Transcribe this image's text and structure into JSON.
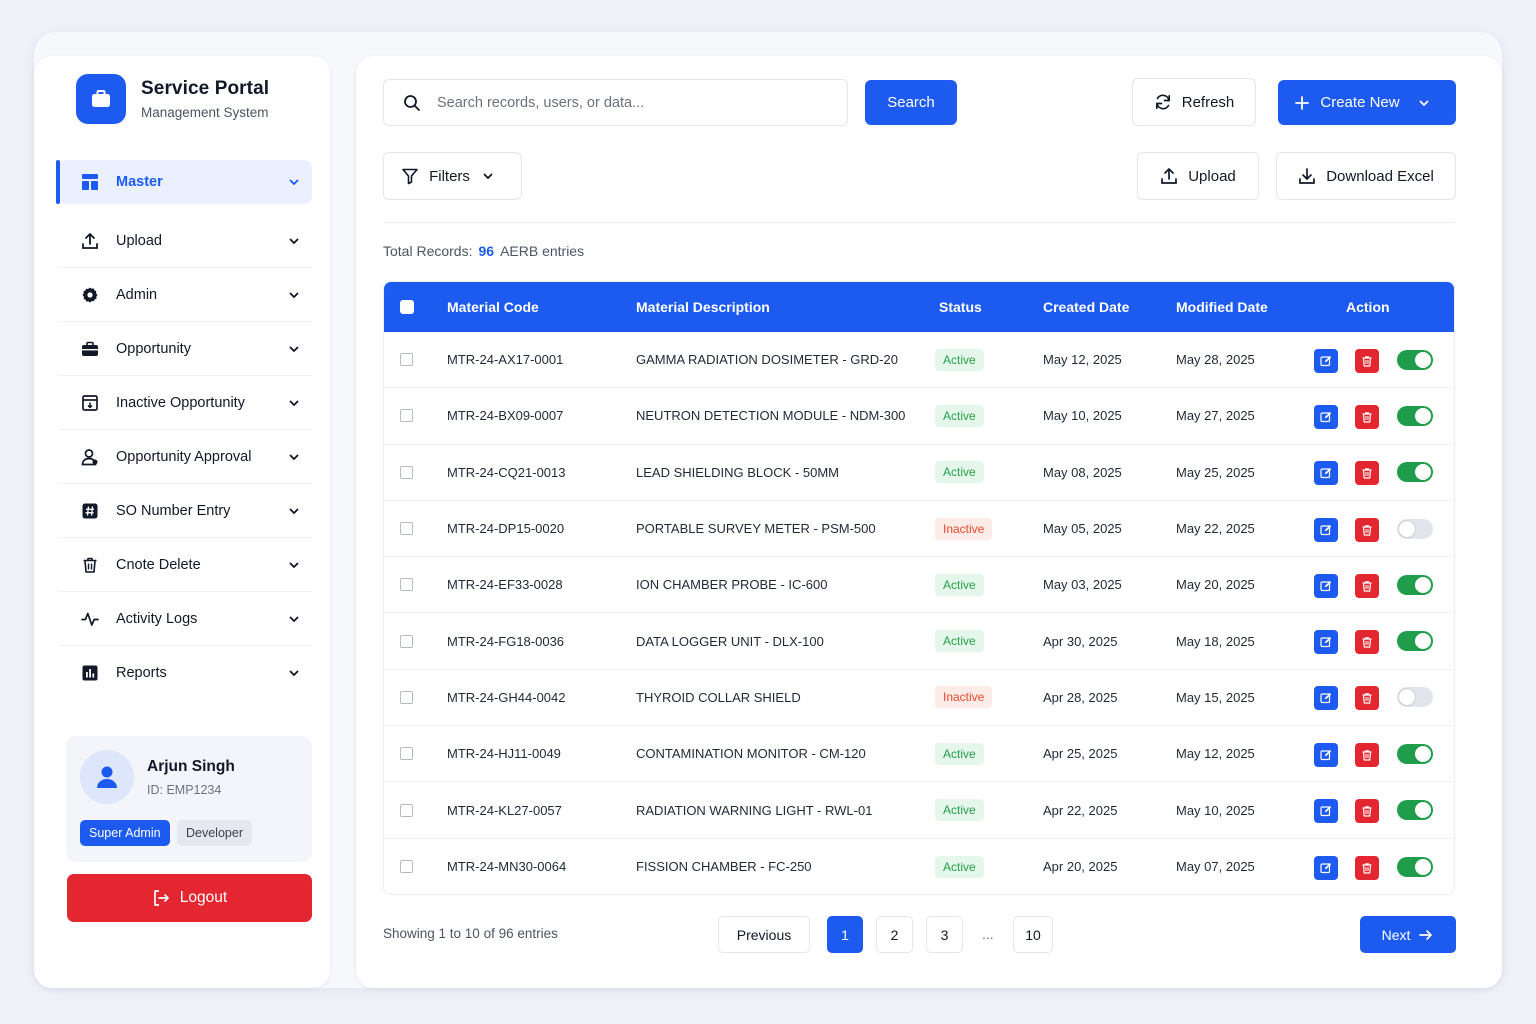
{
  "brand": {
    "title": "Service Portal",
    "subtitle": "Management System"
  },
  "nav": [
    {
      "label": "Master",
      "icon": "layout-icon",
      "active": true
    },
    {
      "label": "Upload",
      "icon": "upload-icon"
    },
    {
      "label": "Admin",
      "icon": "gear-icon"
    },
    {
      "label": "Opportunity",
      "icon": "briefcase-icon"
    },
    {
      "label": "Inactive Opportunity",
      "icon": "archive-icon"
    },
    {
      "label": "Opportunity Approval",
      "icon": "user-check-icon"
    },
    {
      "label": "SO Number Entry",
      "icon": "hash-icon"
    },
    {
      "label": "Cnote Delete",
      "icon": "trash-icon"
    },
    {
      "label": "Activity Logs",
      "icon": "activity-icon"
    },
    {
      "label": "Reports",
      "icon": "bar-chart-icon"
    }
  ],
  "user": {
    "name": "Arjun Singh",
    "id": "ID: EMP1234",
    "roles": [
      "Super Admin",
      "Developer"
    ]
  },
  "logout_label": "Logout",
  "toolbar": {
    "search_placeholder": "Search records, users, or data...",
    "search_label": "Search",
    "refresh_label": "Refresh",
    "create_label": "Create New",
    "filters_label": "Filters",
    "upload_label": "Upload",
    "download_label": "Download Excel"
  },
  "summary": {
    "prefix": "Total Records:",
    "count": "96",
    "suffix": "AERB entries"
  },
  "table": {
    "headers": [
      "Material Code",
      "Material Description",
      "Status",
      "Created Date",
      "Modified Date",
      "Action"
    ],
    "rows": [
      {
        "code": "MTR-24-AX17-0001",
        "desc": "GAMMA RADIATION DOSIMETER - GRD-20",
        "status": "Active",
        "created": "May 12, 2025",
        "modified": "May 28, 2025"
      },
      {
        "code": "MTR-24-BX09-0007",
        "desc": "NEUTRON DETECTION MODULE - NDM-300",
        "status": "Active",
        "created": "May 10, 2025",
        "modified": "May 27, 2025"
      },
      {
        "code": "MTR-24-CQ21-0013",
        "desc": "LEAD SHIELDING BLOCK - 50MM",
        "status": "Active",
        "created": "May 08, 2025",
        "modified": "May 25, 2025"
      },
      {
        "code": "MTR-24-DP15-0020",
        "desc": "PORTABLE SURVEY METER - PSM-500",
        "status": "Inactive",
        "created": "May 05, 2025",
        "modified": "May 22, 2025"
      },
      {
        "code": "MTR-24-EF33-0028",
        "desc": "ION CHAMBER PROBE - IC-600",
        "status": "Active",
        "created": "May 03, 2025",
        "modified": "May 20, 2025"
      },
      {
        "code": "MTR-24-FG18-0036",
        "desc": "DATA LOGGER UNIT - DLX-100",
        "status": "Active",
        "created": "Apr 30, 2025",
        "modified": "May 18, 2025"
      },
      {
        "code": "MTR-24-GH44-0042",
        "desc": "THYROID COLLAR SHIELD",
        "status": "Inactive",
        "created": "Apr 28, 2025",
        "modified": "May 15, 2025"
      },
      {
        "code": "MTR-24-HJ11-0049",
        "desc": "CONTAMINATION MONITOR - CM-120",
        "status": "Active",
        "created": "Apr 25, 2025",
        "modified": "May 12, 2025"
      },
      {
        "code": "MTR-24-KL27-0057",
        "desc": "RADIATION WARNING LIGHT - RWL-01",
        "status": "Active",
        "created": "Apr 22, 2025",
        "modified": "May 10, 2025"
      },
      {
        "code": "MTR-24-MN30-0064",
        "desc": "FISSION CHAMBER - FC-250",
        "status": "Active",
        "created": "Apr 20, 2025",
        "modified": "May 07, 2025"
      }
    ]
  },
  "pagination": {
    "showing": "Showing 1 to 10 of 96 entries",
    "previous": "Previous",
    "pages": [
      "1",
      "2",
      "3",
      "10"
    ],
    "ellipsis": "...",
    "current": "1",
    "next": "Next"
  },
  "colors": {
    "primary": "#1d5bf0",
    "danger": "#e3262f",
    "success": "#1f9d4a"
  }
}
